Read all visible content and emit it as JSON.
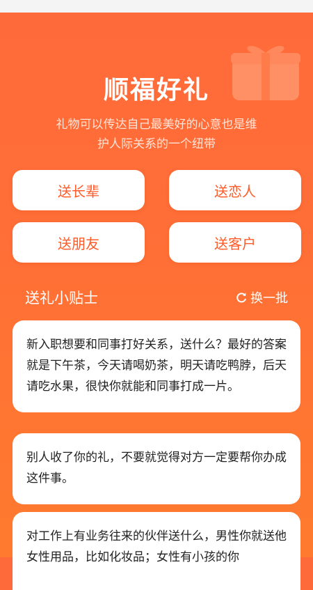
{
  "header": {
    "title": "顺福好礼",
    "subtitle_line1": "礼物可以传达自己最美好的心意也是维",
    "subtitle_line2": "护人际关系的一个纽带"
  },
  "categories": [
    {
      "label": "送长辈"
    },
    {
      "label": "送恋人"
    },
    {
      "label": "送朋友"
    },
    {
      "label": "送客户"
    }
  ],
  "tips": {
    "heading": "送礼小贴士",
    "refresh_label": "换一批",
    "items": [
      {
        "text": "新入职想要和同事打好关系，送什么？最好的答案就是下午茶，今天请喝奶茶，明天请吃鸭脖，后天请吃水果，很快你就能和同事打成一片。"
      },
      {
        "text": "别人收了你的礼，不要就觉得对方一定要帮你办成这件事。"
      },
      {
        "text": "对工作上有业务往来的伙伴送什么，男性你就送他女性用品，比如化妆品；女性有小孩的你"
      }
    ]
  },
  "colors": {
    "accent": "#ff5a28",
    "background_top": "#ff6a3a",
    "background_bottom": "#ff7a2e"
  }
}
